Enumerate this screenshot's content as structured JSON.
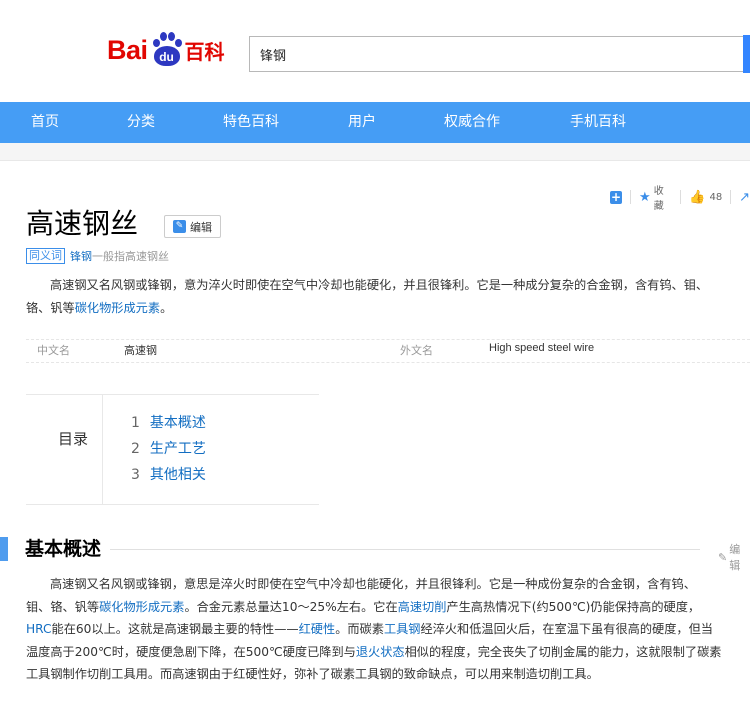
{
  "header": {
    "logo": {
      "bai": "Bai",
      "du": "du",
      "baike": "百科"
    },
    "search": {
      "value": "锋钢"
    }
  },
  "nav": {
    "items": [
      "首页",
      "分类",
      "特色百科",
      "用户",
      "权威合作",
      "手机百科"
    ]
  },
  "tools": {
    "add_glyph": "+",
    "favorite_label": "收藏",
    "like_count": "48",
    "share_glyph": "↗"
  },
  "article": {
    "title": "高速钢丝",
    "edit_label": "编辑",
    "synonym_badge": "同义词",
    "synonym_link": "锋钢",
    "synonym_note": "一般指高速钢丝",
    "summary": {
      "line1": "高速钢又名风钢或锋钢，意为淬火时即使在空气中冷却也能硬化，并且很锋利。它是一种成分复杂的合金钢，含有钨、钼、",
      "line2_prefix": "铬、钒等",
      "line2_link": "碳化物形成元素",
      "line2_suffix": "。"
    },
    "basic_info": [
      {
        "key": "中文名",
        "value": "高速钢"
      },
      {
        "key": "外文名",
        "value": "High speed steel wire"
      }
    ],
    "catalog": {
      "label": "目录",
      "items": [
        {
          "num": "1",
          "text": "基本概述"
        },
        {
          "num": "2",
          "text": "生产工艺"
        },
        {
          "num": "3",
          "text": "其他相关"
        }
      ]
    },
    "section1": {
      "title": "基本概述",
      "edit_label": "编辑",
      "p1_text1": "高速钢又名风钢或锋钢，意思是淬火时即使在空气中冷却也能硬化，并且很锋利。它是一种成份复杂的合金钢，含有钨、",
      "p1_text2": "钼、铬、钒等",
      "p1_link1": "碳化物形成元素",
      "p1_text3": "。合金元素总量达10～25%左右。它在",
      "p1_link2": "高速切削",
      "p1_text4": "产生高热情况下(约500℃)仍能保持高的硬度，",
      "p1_link3": "HRC",
      "p1_text5": "能在60以上。这就是高速钢最主要的特性——",
      "p1_link4": "红硬性",
      "p1_text6": "。而碳素",
      "p1_link5": "工具钢",
      "p1_text7": "经淬火和低温回火后，在室温下虽有很高的硬度，但当",
      "p1_text8": "温度高于200℃时，硬度便急剧下降，在500℃硬度已降到与",
      "p1_link6": "退火状态",
      "p1_text9": "相似的程度，完全丧失了切削金属的能力，这就限制了碳素",
      "p1_text10": "工具钢制作切削工具用。而高速钢由于红硬性好，弥补了碳素工具钢的致命缺点，可以用来制造切削工具。"
    }
  }
}
